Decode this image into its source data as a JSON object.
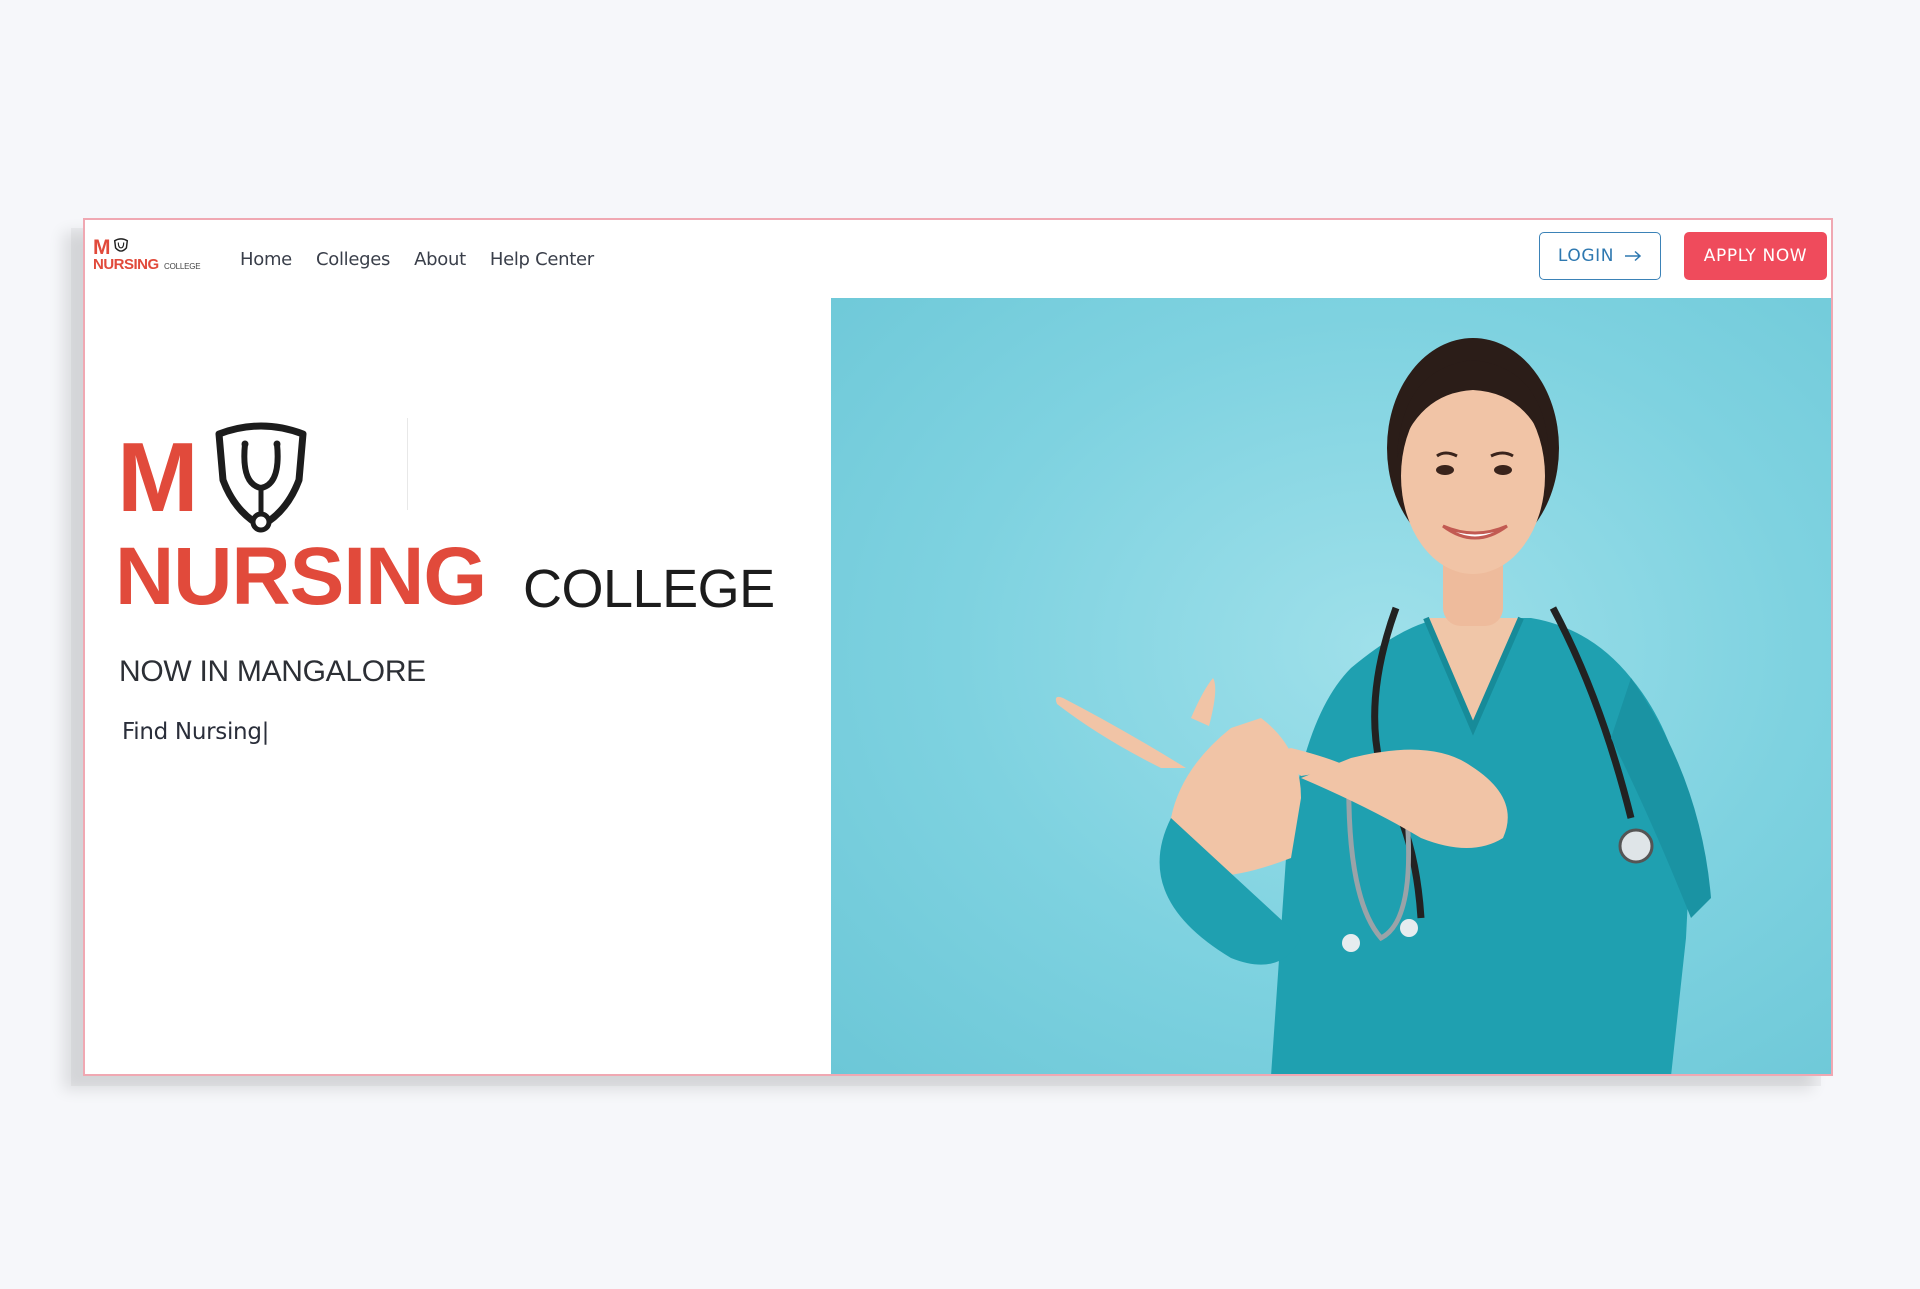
{
  "brand": {
    "logo_m": "M",
    "logo_nursing": "NURSING",
    "logo_college": "COLLEGE"
  },
  "nav": {
    "links": [
      "Home",
      "Colleges",
      "About",
      "Help Center"
    ]
  },
  "actions": {
    "login_label": "LOGIN",
    "apply_label": "APPLY NOW"
  },
  "hero": {
    "logo_m": "M",
    "logo_nursing": "NURSING",
    "logo_college": "COLLEGE",
    "tagline": "NOW IN MANGALORE",
    "typing_text": "Find Nursing|",
    "image_label": "nurse-pointing-photo"
  },
  "colors": {
    "brand_red": "#e14a3b",
    "apply_bg": "#ef4b5c",
    "login_blue": "#2e78b0",
    "photo_bg": "#7ed2e0",
    "scrubs": "#1fa0b0",
    "frame_border": "#f0a8b2"
  }
}
